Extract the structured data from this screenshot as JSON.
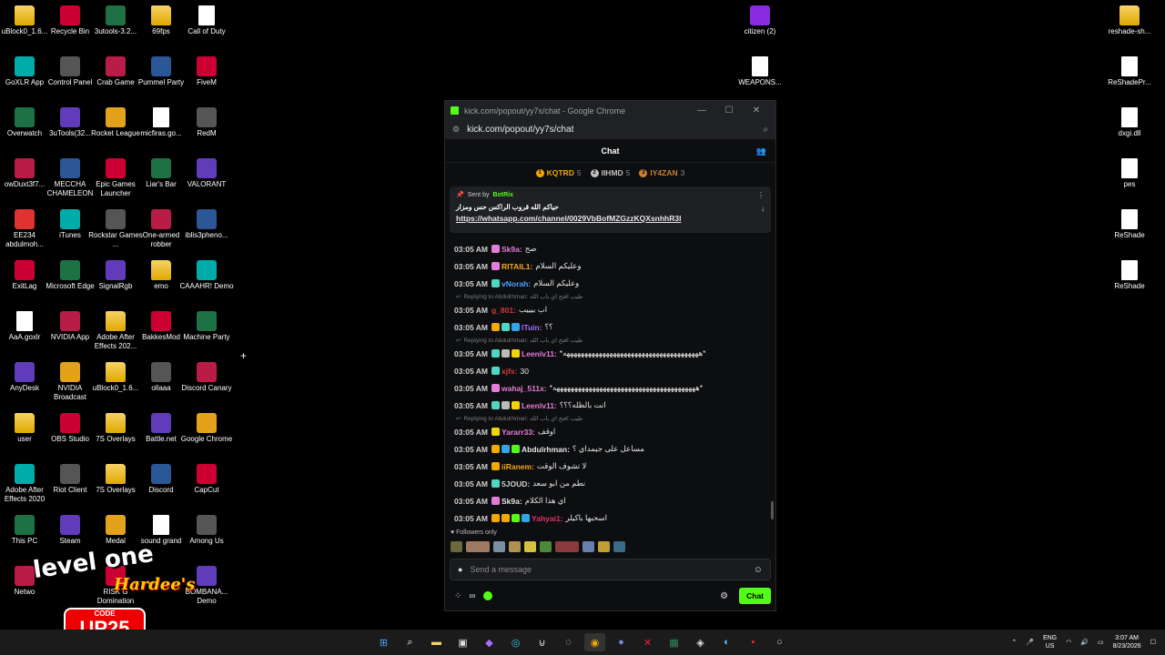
{
  "desktop_icons_left": [
    {
      "label": "uBlock0_1.6...",
      "kind": "folder"
    },
    {
      "label": "Recycle Bin",
      "kind": "recycle"
    },
    {
      "label": "3utools-3.2...",
      "kind": "download"
    },
    {
      "label": "69fps",
      "kind": "folder"
    },
    {
      "label": "Call of Duty",
      "kind": "file"
    },
    {
      "label": "GoXLR App",
      "kind": "app"
    },
    {
      "label": "Control Panel",
      "kind": "app"
    },
    {
      "label": "Crab Game",
      "kind": "app"
    },
    {
      "label": "Pummel Party",
      "kind": "app"
    },
    {
      "label": "FiveM",
      "kind": "app"
    },
    {
      "label": "Overwatch",
      "kind": "app"
    },
    {
      "label": "3uTools(32...",
      "kind": "app"
    },
    {
      "label": "Rocket League",
      "kind": "app"
    },
    {
      "label": "micfiras.go...",
      "kind": "file"
    },
    {
      "label": "RedM",
      "kind": "app"
    },
    {
      "label": "owDuxt3f7...",
      "kind": "app"
    },
    {
      "label": "MECCHA CHAMELEON",
      "kind": "app"
    },
    {
      "label": "Epic Games Launcher",
      "kind": "app"
    },
    {
      "label": "Liar's Bar",
      "kind": "app"
    },
    {
      "label": "VALORANT",
      "kind": "app"
    },
    {
      "label": "EE234 abdulmoh...",
      "kind": "pdf"
    },
    {
      "label": "iTunes",
      "kind": "app"
    },
    {
      "label": "Rockstar Games ...",
      "kind": "app"
    },
    {
      "label": "One-armed robber",
      "kind": "app"
    },
    {
      "label": "iblis3pheno...",
      "kind": "app"
    },
    {
      "label": "ExitLag",
      "kind": "app"
    },
    {
      "label": "Microsoft Edge",
      "kind": "app"
    },
    {
      "label": "SignalRgb",
      "kind": "app"
    },
    {
      "label": "emo",
      "kind": "folder"
    },
    {
      "label": "CAAAHR! Demo",
      "kind": "app"
    },
    {
      "label": "AaA.goxlr",
      "kind": "file"
    },
    {
      "label": "NVIDIA App",
      "kind": "app"
    },
    {
      "label": "Adobe After Effects 202...",
      "kind": "folder"
    },
    {
      "label": "BakkesMod",
      "kind": "app"
    },
    {
      "label": "Machine Party",
      "kind": "app"
    },
    {
      "label": "AnyDesk",
      "kind": "app"
    },
    {
      "label": "NVIDIA Broadcast",
      "kind": "app"
    },
    {
      "label": "uBlock0_1.6...",
      "kind": "folder"
    },
    {
      "label": "ollaaa",
      "kind": "app"
    },
    {
      "label": "Discord Canary",
      "kind": "app"
    },
    {
      "label": "user",
      "kind": "folder"
    },
    {
      "label": "OBS Studio",
      "kind": "app"
    },
    {
      "label": "7S Overlays",
      "kind": "folder"
    },
    {
      "label": "Battle.net",
      "kind": "app"
    },
    {
      "label": "Google Chrome",
      "kind": "app"
    },
    {
      "label": "Adobe After Effects 2020",
      "kind": "app"
    },
    {
      "label": "Riot Client",
      "kind": "app"
    },
    {
      "label": "7S Overlays",
      "kind": "folder"
    },
    {
      "label": "Discord",
      "kind": "app"
    },
    {
      "label": "CapCut",
      "kind": "app"
    },
    {
      "label": "This PC",
      "kind": "app"
    },
    {
      "label": "Steam",
      "kind": "app"
    },
    {
      "label": "Medal",
      "kind": "app"
    },
    {
      "label": "sound grand",
      "kind": "file"
    },
    {
      "label": "Among Us",
      "kind": "app"
    },
    {
      "label": "Netwo",
      "kind": "app"
    },
    {
      "label": "",
      "kind": "none"
    },
    {
      "label": "RISK G Domination",
      "kind": "app"
    },
    {
      "label": "",
      "kind": "none"
    },
    {
      "label": "BOMBANA... Demo",
      "kind": "app"
    }
  ],
  "desktop_icons_right": [
    {
      "label": "citizen (2)",
      "kind": "app",
      "pos": "c1r1"
    },
    {
      "label": "WEAPONS...",
      "kind": "file",
      "pos": "c1r2"
    },
    {
      "label": "reshade-sh...",
      "kind": "folder",
      "pos": "c2r1"
    },
    {
      "label": "ReShadePr...",
      "kind": "file",
      "pos": "c2r2"
    },
    {
      "label": "dxgi.dll",
      "kind": "file",
      "pos": "c2r3"
    },
    {
      "label": "pes",
      "kind": "file",
      "pos": "c2r4"
    },
    {
      "label": "ReShade",
      "kind": "file",
      "pos": "c2r5"
    },
    {
      "label": "ReShade",
      "kind": "file",
      "pos": "c2r6"
    }
  ],
  "window": {
    "title": "kick.com/popout/yy7s/chat - Google Chrome",
    "url": "kick.com/popout/yy7s/chat",
    "minimize": "—",
    "maximize": "☐",
    "close": "✕"
  },
  "chat": {
    "header": "Chat",
    "leaderboard": [
      {
        "name": "KQTRD",
        "count": "5",
        "color": "#f2a900",
        "rank": "1"
      },
      {
        "name": "IIHMD",
        "count": "5",
        "color": "#c0c0c0",
        "rank": "2"
      },
      {
        "name": "IY4ZAN",
        "count": "3",
        "color": "#cd7f32",
        "rank": "3"
      }
    ],
    "pinned": {
      "sent_by": "Sent by",
      "bot": "BotRix",
      "message": "حياكم الله قروب الراكس حس ومزار",
      "link": "https://whatsapp.com/channel/0029VbBofMZGzzKQXsnhhR3l"
    },
    "messages": [
      {
        "type": "msg",
        "time": "03:05 AM",
        "user": "Sk9a:",
        "color": "#e47cd9",
        "badges": [
          "#e47cd9"
        ],
        "text": "صح"
      },
      {
        "type": "msg",
        "time": "03:05 AM",
        "user": "RITAIL1:",
        "color": "#f5a623",
        "badges": [
          "#e47cd9"
        ],
        "text": "وعليكم السلام"
      },
      {
        "type": "msg",
        "time": "03:05 AM",
        "user": "vNorah:",
        "color": "#4aa3ff",
        "badges": [
          "#4cd7c4"
        ],
        "text": "وعليكم السلام"
      },
      {
        "type": "reply",
        "text": "Replying to Abdulrhman: طيب افتح اي باب الله"
      },
      {
        "type": "msg",
        "time": "03:05 AM",
        "user": "g_801:",
        "color": "#d23a3a",
        "badges": [],
        "text": "اب بيييب"
      },
      {
        "type": "msg",
        "time": "03:05 AM",
        "user": "ITuin:",
        "color": "#a970ff",
        "badges": [
          "#f2a900",
          "#4cd7c4",
          "#35a3e8"
        ],
        "text": "؟؟"
      },
      {
        "type": "reply",
        "text": "Replying to Abdulrhman: طيب افتح اي باب الله"
      },
      {
        "type": "msg",
        "time": "03:05 AM",
        "user": "Leenlv11:",
        "color": "#e47cd9",
        "badges": [
          "#4cd7c4",
          "#bbbbbb",
          "#f2d600"
        ],
        "text": "*ههههههههههههههههههههههههههههههههههههههه*"
      },
      {
        "type": "msg",
        "time": "03:05 AM",
        "user": "xjfs:",
        "color": "#d23a3a",
        "badges": [
          "#4cd7c4"
        ],
        "text": "30"
      },
      {
        "type": "msg",
        "time": "03:05 AM",
        "user": "wahaj_511x:",
        "color": "#e47cd9",
        "badges": [
          "#e47cd9"
        ],
        "text": "*ههههههههههههههههههههههههههههههههههههههههه*"
      },
      {
        "type": "msg",
        "time": "03:05 AM",
        "user": "Leenlv11:",
        "color": "#e47cd9",
        "badges": [
          "#4cd7c4",
          "#bbbbbb",
          "#f2d600"
        ],
        "text": "انت بالظله؟؟؟"
      },
      {
        "type": "reply",
        "text": "Replying to Abdulrhman: طيب افتح اي باب الله"
      },
      {
        "type": "msg",
        "time": "03:05 AM",
        "user": "Yararr33:",
        "color": "#e47cd9",
        "badges": [
          "#f2d600"
        ],
        "text": "اوقف"
      },
      {
        "type": "msg",
        "time": "03:05 AM",
        "user": "Abdulrhman:",
        "color": "#e6e6e6",
        "badges": [
          "#f2a900",
          "#35a3e8",
          "#53fc18"
        ],
        "text": "مساعل على جيمداي ؟"
      },
      {
        "type": "msg",
        "time": "03:05 AM",
        "user": "iiRanem:",
        "color": "#f5a623",
        "badges": [
          "#f2a900"
        ],
        "text": "لا تشوف الوقت"
      },
      {
        "type": "msg",
        "time": "03:05 AM",
        "user": "5JOUD:",
        "color": "#d0d0d0",
        "badges": [
          "#4cd7c4"
        ],
        "text": "نطم من ابو سعد"
      },
      {
        "type": "msg",
        "time": "03:05 AM",
        "user": "Sk9a:",
        "color": "#e6e6e6",
        "badges": [
          "#e47cd9"
        ],
        "text": "اي هذا الكلام"
      },
      {
        "type": "msg",
        "time": "03:05 AM",
        "user": "Yahyai1:",
        "color": "#e2336b",
        "badges": [
          "#f2a900",
          "#f2a900",
          "#53fc18",
          "#35a3e8"
        ],
        "text": "اسحبها باكيلر"
      }
    ],
    "followers_only": "Followers only",
    "input_placeholder": "Send a message",
    "send_label": "Chat"
  },
  "taskbar": {
    "lang_top": "ENG",
    "lang_bottom": "US",
    "time": "3:07 AM",
    "date": "8/23/2026"
  },
  "promo": {
    "brand_top": "level one",
    "brand": "Hardee's",
    "code_label": "CODE",
    "code": "UP25"
  }
}
